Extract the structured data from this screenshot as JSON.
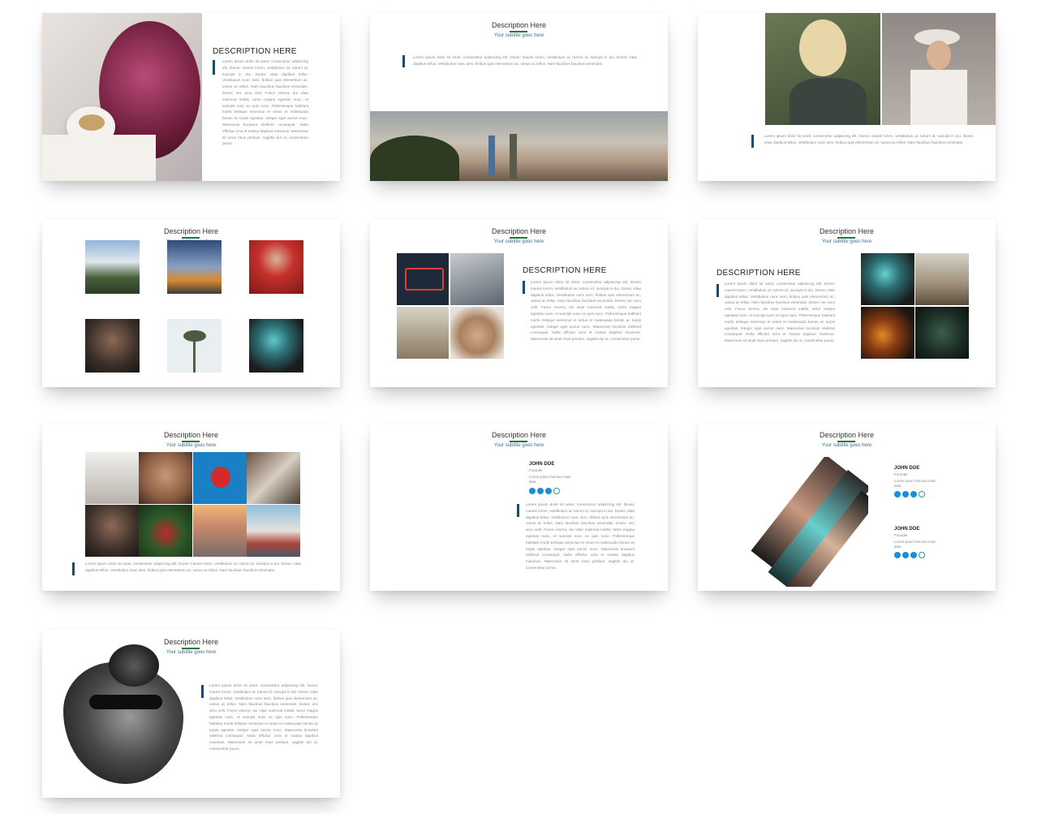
{
  "heading_caps": "DESCRIPTION HERE",
  "title": "Description Here",
  "subtitle": "Your subtitle goes here",
  "lorem_long": "Lorem ipsum dolor sit amet, consectetur adipiscing elit. Donec mauris lorem, vestibulum ac rutrum id, suscipit in dui. Donec vitae dapibus tellus. Vestibulum nunc sem, finibus quis elementum ac, varius ac tellus. Nam faucibus faucibus venenatis. Donec nec arcu velit. Fusce viverra, dui vitae euismod mattis, tortor magna egestas nunc, et suscipit nunc ex quis nunc. Pellentesque habitant morbi tristique senectus et netus et malesuada fames ac turpis egestas. Integer eget auctor nunc. Maecenas tincidunt eleifend consequat. Nulla efficitur urna et massa dapibus maximus. Maecenas sit amet risus pretium, sagittis dui ut, consectetur purus.",
  "lorem_short": "Lorem ipsum dolor sit amet, consectetur adipiscing elit. Donec mauris lorem, vestibulum ac rutrum id, suscipit in dui. Donec vitae dapibus tellus. Vestibulum nunc sem, finibus quis elementum ac, varius ac tellus. Nam faucibus faucibus venenatis.",
  "person": {
    "name": "JOHN DOE",
    "role": "Founder",
    "bio": "Lorem ipsum has two main data"
  },
  "colors": {
    "accent_green": "#1e7b3e",
    "bar_navy": "#1c4a6c",
    "subtitle_blue": "#3a6f8f",
    "social_blue": "#1a8fd6",
    "social_teal": "#1aa39a"
  },
  "icons": [
    "facebook-icon",
    "twitter-icon",
    "linkedin-icon",
    "skype-icon"
  ]
}
